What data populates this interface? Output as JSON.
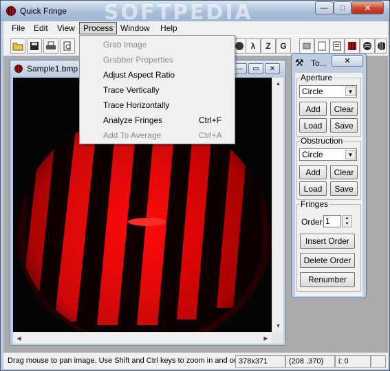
{
  "window": {
    "title": "Quick Fringe",
    "watermark": "SOFTPEDIA",
    "min": "—",
    "max": "□",
    "close": "✕"
  },
  "menubar": {
    "items": [
      "File",
      "Edit",
      "View",
      "Process",
      "Window",
      "Help"
    ]
  },
  "toolbar": {
    "text_buttons": [
      "λ",
      "Z",
      "G"
    ]
  },
  "process_menu": {
    "items": [
      {
        "label": "Grab Image",
        "shortcut": "",
        "enabled": false
      },
      {
        "label": "Grabber Properties",
        "shortcut": "",
        "enabled": false
      },
      {
        "label": "Adjust Aspect Ratio",
        "shortcut": "",
        "enabled": true
      },
      {
        "label": "Trace Vertically",
        "shortcut": "",
        "enabled": true
      },
      {
        "label": "Trace Horizontally",
        "shortcut": "",
        "enabled": true
      },
      {
        "label": "Analyze Fringes",
        "shortcut": "Ctrl+F",
        "enabled": true
      },
      {
        "label": "Add To Average",
        "shortcut": "Ctrl+A",
        "enabled": false
      }
    ]
  },
  "image_window": {
    "title": "Sample1.bmp"
  },
  "tools": {
    "title": "To...",
    "close": "✕",
    "aperture": {
      "legend": "Aperture",
      "shape": "Circle",
      "add": "Add",
      "clear": "Clear",
      "load": "Load",
      "save": "Save"
    },
    "obstruction": {
      "legend": "Obstruction",
      "shape": "Circle",
      "add": "Add",
      "clear": "Clear",
      "load": "Load",
      "save": "Save"
    },
    "fringes": {
      "legend": "Fringes",
      "order_label": "Order",
      "order_value": "1",
      "insert": "Insert Order",
      "delete": "Delete Order",
      "renumber": "Renumber"
    }
  },
  "status": {
    "hint": "Drag mouse to pan image. Use Shift and Ctrl keys to zoom in and out",
    "size": "378x371",
    "coords": "(208 ,370)",
    "index": "i: 0"
  },
  "colors": {
    "fringe": "#ff0a0a",
    "background": "#050505",
    "accent": "#bfcde0"
  }
}
